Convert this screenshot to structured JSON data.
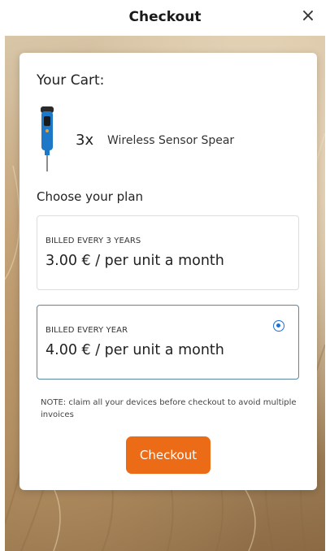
{
  "header": {
    "title": "Checkout",
    "close_symbol": "×"
  },
  "cart": {
    "heading": "Your Cart:",
    "item": {
      "quantity": "3x",
      "name": "Wireless Sensor Spear",
      "image_icon": "sensor-spear-icon"
    }
  },
  "plans": {
    "heading": "Choose your plan",
    "options": [
      {
        "billing": "BILLED EVERY 3 YEARS",
        "price": "3.00  € / per unit a month",
        "selected": false
      },
      {
        "billing": "BILLED EVERY YEAR",
        "price": "4.00  € / per unit a month",
        "selected": true
      }
    ]
  },
  "note": "NOTE: claim all your devices before checkout to avoid multiple invoices",
  "checkout_button": "Checkout",
  "colors": {
    "accent": "#ec6b16",
    "selected_border": "#5b86a4",
    "radio": "#1e6fd9",
    "product_blue": "#1e78c8"
  }
}
